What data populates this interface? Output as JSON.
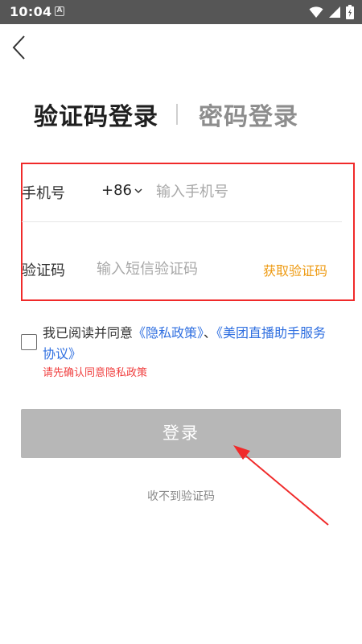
{
  "status_bar": {
    "time": "10:04",
    "notification_badge": "A",
    "icons": [
      "wifi-icon",
      "signal-icon",
      "battery-icon"
    ]
  },
  "tabs": {
    "active": "验证码登录",
    "inactive": "密码登录"
  },
  "form": {
    "phone_label": "手机号",
    "country_code": "+86",
    "phone_placeholder": "输入手机号",
    "phone_value": "",
    "code_label": "验证码",
    "code_placeholder": "输入短信验证码",
    "code_value": "",
    "get_code": "获取验证码"
  },
  "agreement": {
    "checked": false,
    "prefix": "我已阅读并同意",
    "privacy_link": "《隐私政策》",
    "separator": "、",
    "service_link": "《美团直播助手服务协议》",
    "warning": "请先确认同意隐私政策"
  },
  "login_button": "登录",
  "no_code_link": "收不到验证码",
  "colors": {
    "accent_orange": "#ee9a11",
    "link_blue": "#2f6fe0",
    "warning_red": "#f04040",
    "annotation_red": "#f02a2a",
    "button_disabled": "#b7b7b7"
  }
}
